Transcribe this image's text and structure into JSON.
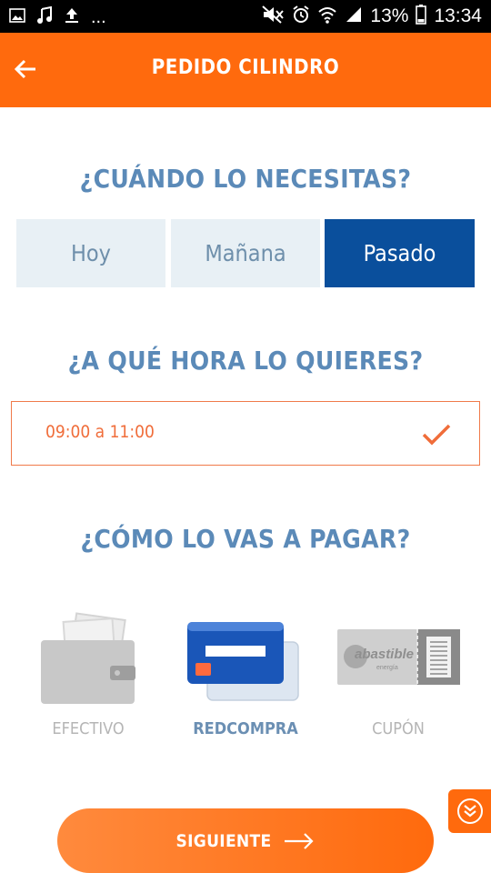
{
  "status_bar": {
    "battery": "13%",
    "time": "13:34",
    "dots": "...",
    "icons": [
      "image-icon",
      "music-icon",
      "upload-icon",
      "mute-icon",
      "alarm-icon",
      "wifi-icon",
      "signal-icon",
      "battery-icon"
    ]
  },
  "app_bar": {
    "title": "PEDIDO CILINDRO",
    "back_icon": "arrow-left-icon",
    "background": "#ff6a0d"
  },
  "when": {
    "question": "¿CUÁNDO LO NECESITAS?",
    "options": [
      "Hoy",
      "Mañana",
      "Pasado"
    ],
    "selected": "Pasado",
    "active_color": "#0a4f9c"
  },
  "time": {
    "question": "¿A QUÉ HORA LO QUIERES?",
    "value": "09:00 a 11:00",
    "icon": "check-icon"
  },
  "payment": {
    "question": "¿CÓMO LO VAS A PAGAR?",
    "options": [
      {
        "label": "EFECTIVO",
        "icon": "wallet-icon"
      },
      {
        "label": "REDCOMPRA",
        "icon": "credit-card-icon"
      },
      {
        "label": "CUPÓN",
        "icon": "coupon-icon",
        "logo_text": "abastible",
        "logo_subtext": "energía"
      }
    ],
    "selected": "REDCOMPRA"
  },
  "next_button": {
    "label": "SIGUIENTE",
    "icon": "arrow-right-icon"
  },
  "scroll_button": {
    "icon": "double-chevron-down-icon"
  }
}
